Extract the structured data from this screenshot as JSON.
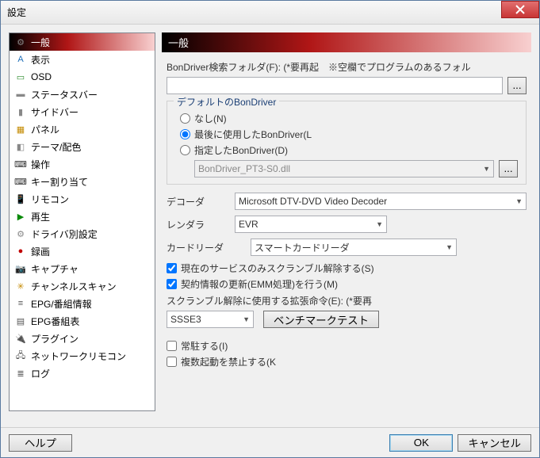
{
  "window": {
    "title": "設定"
  },
  "sidebar": {
    "items": [
      {
        "icon": "⚙",
        "label": "一般",
        "color": "#888"
      },
      {
        "icon": "A",
        "label": "表示",
        "color": "#1e6fb8"
      },
      {
        "icon": "▭",
        "label": "OSD",
        "color": "#2a8a2a"
      },
      {
        "icon": "▬",
        "label": "ステータスバー",
        "color": "#888"
      },
      {
        "icon": "▮",
        "label": "サイドバー",
        "color": "#888"
      },
      {
        "icon": "▦",
        "label": "パネル",
        "color": "#c48a00"
      },
      {
        "icon": "◧",
        "label": "テーマ/配色",
        "color": "#888"
      },
      {
        "icon": "⌨",
        "label": "操作",
        "color": "#333"
      },
      {
        "icon": "⌨",
        "label": "キー割り当て",
        "color": "#333"
      },
      {
        "icon": "📱",
        "label": "リモコン",
        "color": "#555"
      },
      {
        "icon": "▶",
        "label": "再生",
        "color": "#0a8a0a"
      },
      {
        "icon": "⚙",
        "label": "ドライバ別設定",
        "color": "#888"
      },
      {
        "icon": "●",
        "label": "録画",
        "color": "#c00000"
      },
      {
        "icon": "📷",
        "label": "キャプチャ",
        "color": "#555"
      },
      {
        "icon": "✳",
        "label": "チャンネルスキャン",
        "color": "#c48a00"
      },
      {
        "icon": "≡",
        "label": "EPG/番組情報",
        "color": "#555"
      },
      {
        "icon": "▤",
        "label": "EPG番組表",
        "color": "#555"
      },
      {
        "icon": "🔌",
        "label": "プラグイン",
        "color": "#333"
      },
      {
        "icon": "🖧",
        "label": "ネットワークリモコン",
        "color": "#555"
      },
      {
        "icon": "≣",
        "label": "ログ",
        "color": "#555"
      }
    ],
    "selectedIndex": 0
  },
  "main": {
    "header": "一般",
    "folder": {
      "label": "BonDriver検索フォルダ(F): (*要再起　※空欄でプログラムのあるフォル",
      "value": "",
      "browse": "..."
    },
    "defaultDriver": {
      "title": "デフォルトのBonDriver",
      "options": {
        "none": "なし(N)",
        "last": "最後に使用したBonDriver(L",
        "specified": "指定したBonDriver(D)"
      },
      "selected": "last",
      "specifiedValue": "BonDriver_PT3-S0.dll",
      "specifiedBrowse": "..."
    },
    "decoder": {
      "label": "デコーダ",
      "value": "Microsoft DTV-DVD Video Decoder"
    },
    "renderer": {
      "label": "レンダラ",
      "value": "EVR"
    },
    "cardReader": {
      "label": "カードリーダ",
      "value": "スマートカードリーダ"
    },
    "checks": {
      "scramble": {
        "label": "現在のサービスのみスクランブル解除する(S)",
        "checked": true
      },
      "emm": {
        "label": "契約情報の更新(EMM処理)を行う(M)",
        "checked": true
      }
    },
    "ext": {
      "label": "スクランブル解除に使用する拡張命令(E): (*要再",
      "combo": "SSSE3",
      "bench": "ベンチマークテスト"
    },
    "checks2": {
      "resident": {
        "label": "常駐する(I)",
        "checked": false
      },
      "single": {
        "label": "複数起動を禁止する(K",
        "checked": false
      }
    }
  },
  "footer": {
    "help": "ヘルプ",
    "ok": "OK",
    "cancel": "キャンセル"
  }
}
